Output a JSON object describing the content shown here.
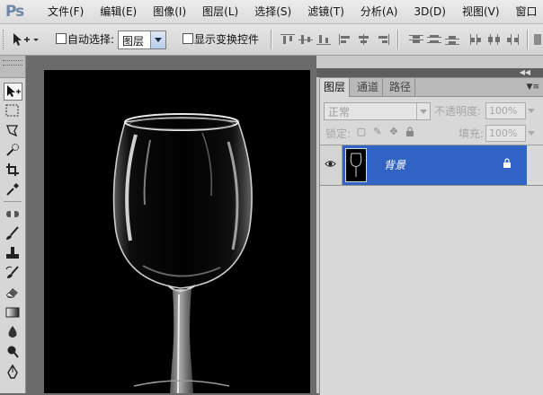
{
  "app": {
    "logo": "Ps"
  },
  "menu": [
    "文件(F)",
    "编辑(E)",
    "图像(I)",
    "图层(L)",
    "选择(S)",
    "滤镜(T)",
    "分析(A)",
    "3D(D)",
    "视图(V)",
    "窗口"
  ],
  "options": {
    "auto_select_label": "自动选择:",
    "auto_select_value": "图层",
    "show_transform_label": "显示变换控件"
  },
  "tools": [
    "move-icon",
    "marquee-icon",
    "lasso-icon",
    "quick-select-icon",
    "crop-icon",
    "eyedropper-icon",
    "healing-icon",
    "brush-icon",
    "clone-stamp-icon",
    "history-brush-icon",
    "eraser-icon",
    "gradient-icon",
    "blur-icon",
    "dodge-icon",
    "pen-icon"
  ],
  "layers_panel": {
    "tabs": [
      "图层",
      "通道",
      "路径"
    ],
    "blend_mode": "正常",
    "opacity_label": "不透明度:",
    "opacity_value": "100%",
    "lock_label": "锁定:",
    "fill_label": "填充:",
    "fill_value": "100%",
    "layers": [
      {
        "name": "背景",
        "visible": true,
        "locked": true,
        "selected": true
      }
    ]
  },
  "colors": {
    "selection": "#3063c4",
    "canvas": "#000000",
    "workspace": "#6b6b6b"
  }
}
